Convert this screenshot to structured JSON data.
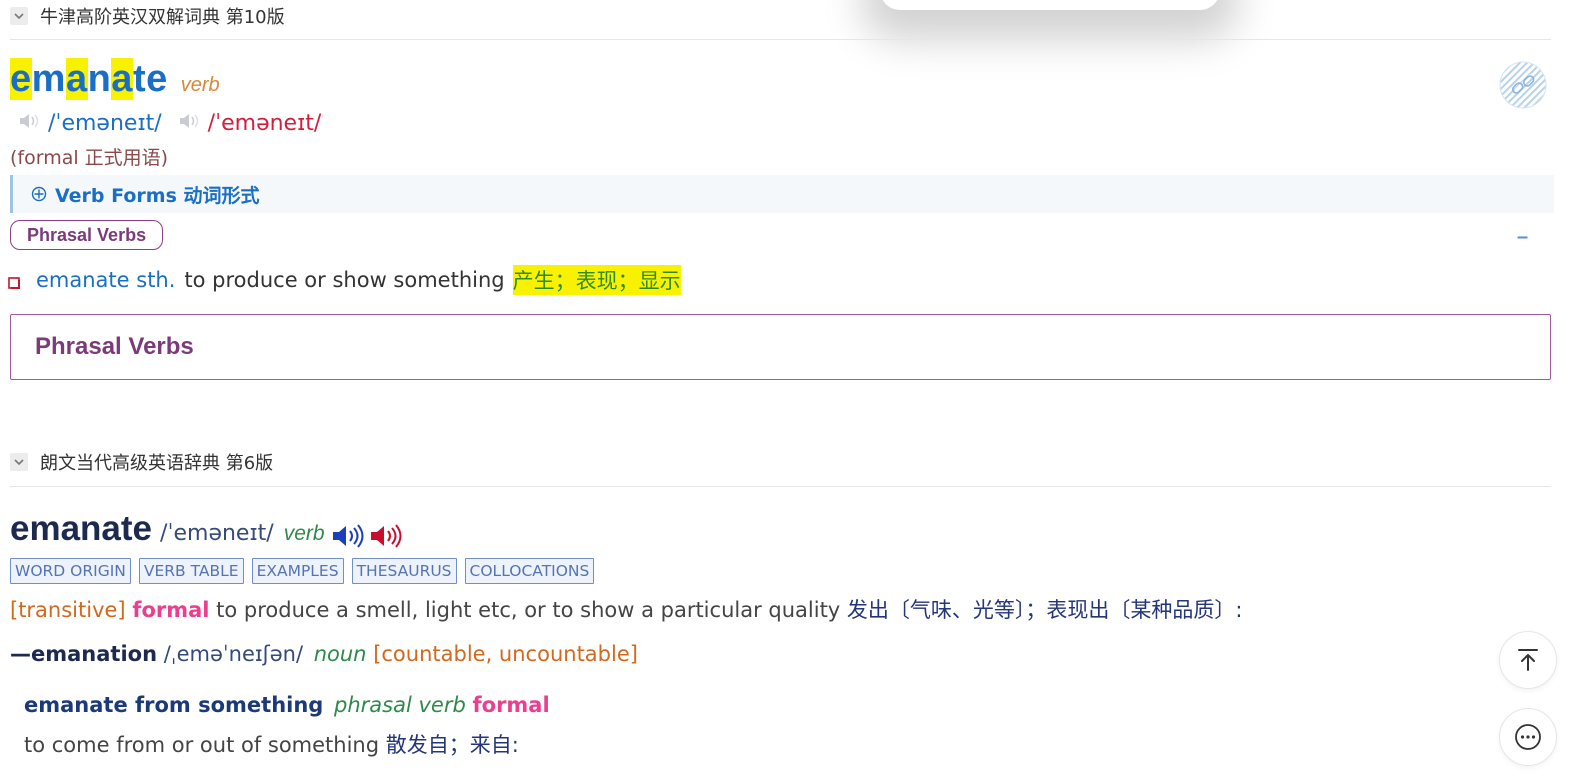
{
  "oxford": {
    "dict_title": "牛津高阶英汉双解词典 第10版",
    "headword_parts": [
      "e",
      "m",
      "a",
      "n",
      "a",
      "te"
    ],
    "pos": "verb",
    "phon_br": "/ˈeməneɪt/",
    "phon_us": "/ˈeməneɪt/",
    "register": "(formal 正式用语)",
    "verb_forms_label": "Verb Forms 动词形式",
    "phrasal_pill": "Phrasal Verbs",
    "collapse_label": "–",
    "sense": {
      "pattern": "emanate sth.",
      "definition": "to produce or show something",
      "translation": "产生；表现；显示"
    },
    "phrasal_box_title": "Phrasal Verbs"
  },
  "longman": {
    "dict_title": "朗文当代高级英语辞典 第6版",
    "headword": "emanate",
    "phon": "/ˈeməneɪt/",
    "pos": "verb",
    "tags": [
      "WORD ORIGIN",
      "VERB TABLE",
      "EXAMPLES",
      "THESAURUS",
      "COLLOCATIONS"
    ],
    "definition": {
      "grammar": "[transitive]",
      "register": "formal",
      "text": "to produce a smell, light etc, or to show a particular quality",
      "translation": "发出〔气味、光等〕；表现出〔某种品质〕:"
    },
    "derived": {
      "word": "—emanation",
      "phon": "/ˌeməˈneɪʃən/",
      "pos": "noun",
      "grammar": "[countable, uncountable]"
    },
    "phrasal": {
      "phrase": "emanate from something",
      "type": "phrasal verb",
      "register": "formal",
      "definition": "to come from or out of something",
      "translation": "散发自；来自:"
    }
  },
  "icons": {
    "oxford_logo": "link-badge-icon",
    "back_to_top": "arrow-up-to-top-icon",
    "more": "more-dots-icon"
  },
  "colors": {
    "headword_blue": "#1a6fc4",
    "highlight_yellow": "#f8f200",
    "phrasal_purple": "#7b3a7b",
    "longman_navy": "#1c2a50",
    "formal_pink": "#ea3f8e"
  }
}
